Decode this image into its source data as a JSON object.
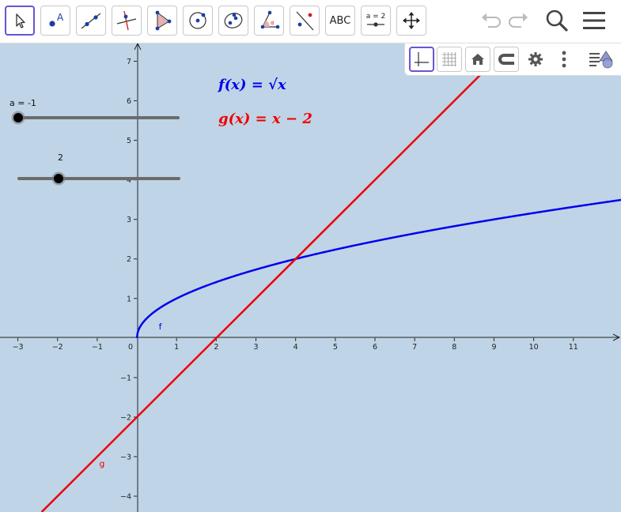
{
  "toolbar": {
    "text_tool_label": "ABC",
    "slider_tool_label": "a = 2",
    "tools": [
      "move",
      "point",
      "line",
      "perpendicular-line",
      "polygon",
      "circle",
      "ellipse",
      "angle",
      "reflect",
      "text",
      "slider",
      "move-graphics-view"
    ]
  },
  "graph": {
    "x_ticks": [
      "−3",
      "−2",
      "−1",
      "0",
      "1",
      "2",
      "3",
      "4",
      "5",
      "6",
      "7",
      "8",
      "9",
      "10",
      "11"
    ],
    "y_ticks_positive": [
      "7",
      "6",
      "5",
      "4",
      "3",
      "2",
      "1"
    ],
    "y_ticks_negative": [
      "−1",
      "−2",
      "−3",
      "−4"
    ],
    "x_range": [
      -3.45,
      12.2
    ],
    "y_range": [
      -4.4,
      7.45
    ],
    "functions": [
      {
        "name": "f",
        "label": "f",
        "expression": "√x",
        "color": "#0000ee"
      },
      {
        "name": "g",
        "label": "g",
        "expression": "x − 2",
        "color": "#ee0000"
      }
    ],
    "formulas": {
      "f": "f(x) = √x",
      "g": "g(x) = x − 2"
    }
  },
  "sliders": [
    {
      "label": "a = -1",
      "value": -1,
      "min": -1,
      "max": 3
    },
    {
      "label": "2",
      "value": 2,
      "min": 1,
      "max": 5
    }
  ],
  "colors": {
    "background": "#bfd4e6",
    "f": "#0000ee",
    "g": "#ee0000",
    "accent": "#6557d2"
  }
}
